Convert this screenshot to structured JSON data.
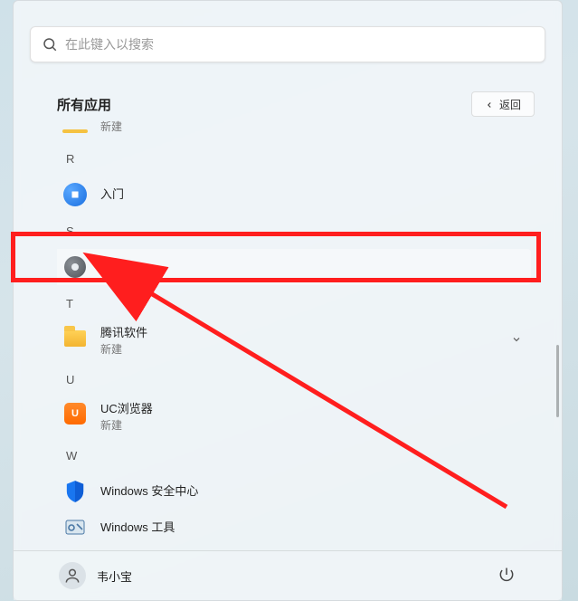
{
  "search": {
    "placeholder": "在此键入以搜索"
  },
  "header": {
    "title": "所有应用",
    "back_label": "返回"
  },
  "apps": {
    "truncated_top": {
      "sub": "新建"
    },
    "letter_R": "R",
    "tips": {
      "label": "入门"
    },
    "letter_S": "S",
    "settings": {
      "label": "设置"
    },
    "letter_T": "T",
    "tencent": {
      "label": "腾讯软件",
      "sub": "新建"
    },
    "letter_U": "U",
    "uc": {
      "label": "UC浏览器",
      "sub": "新建"
    },
    "letter_W": "W",
    "security": {
      "label": "Windows 安全中心"
    },
    "tools": {
      "label": "Windows 工具"
    }
  },
  "user": {
    "name": "韦小宝"
  }
}
